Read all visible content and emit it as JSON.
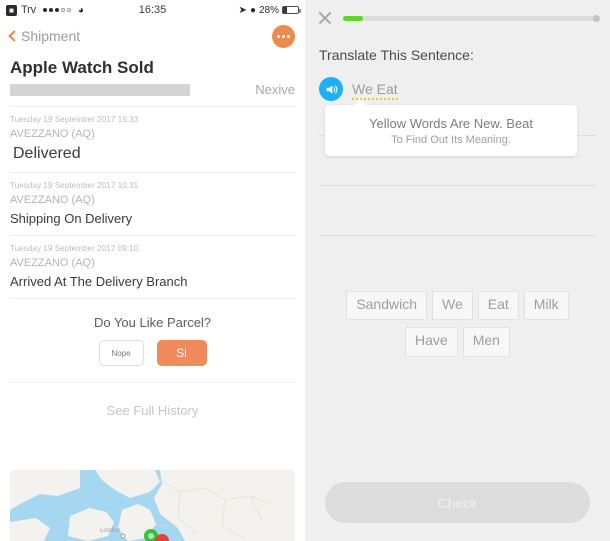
{
  "status_bar": {
    "carrier_icon": "carrier-badge-icon",
    "carrier": "Trv",
    "signal_dots": [
      true,
      true,
      true,
      false,
      false
    ],
    "wifi_icon": "wifi-icon",
    "time": "16:35",
    "location_icon": "location-arrow-icon",
    "alarm_icon": "alarm-icon",
    "battery_percent": "28%",
    "battery_icon": "battery-icon"
  },
  "left_panel": {
    "nav": {
      "back_icon": "chevron-left-icon",
      "back_label": "Shipment",
      "more_button_icon": "ellipsis-icon"
    },
    "shipment": {
      "title": "Apple Watch Sold",
      "code_placeholder_bar": "redacted-tracking-code",
      "carrier_name": "Nexive"
    },
    "events": [
      {
        "timestamp": "Tuesday 19 September 2017 15:33",
        "location": "AVEZZANO (AQ)",
        "status": "Delivered",
        "emphasis": true
      },
      {
        "timestamp": "Tuesday 19 September 2017 10:31",
        "location": "AVEZZANO (AQ)",
        "status": "Shipping On Delivery",
        "emphasis": false
      },
      {
        "timestamp": "Tuesday 19 September 2017 09:10",
        "location": "AVEZZANO (AQ)",
        "status": "Arrived At The Delivery Branch",
        "emphasis": false
      }
    ],
    "feedback": {
      "question": "Do You Like Parcel?",
      "no_label": "Nope",
      "yes_label": "Si"
    },
    "history_link": "See Full History",
    "map": {
      "label_london": "London",
      "marker_green": "map-marker-green",
      "marker_red": "map-marker-red"
    }
  },
  "right_panel": {
    "close_icon": "close-icon",
    "progress": {
      "value_percent": 8,
      "fill_color": "#5fd52a",
      "track_color": "#dcdcdc"
    },
    "prompt": "Translate This Sentence:",
    "speaker_icon": "speaker-icon",
    "sentence": "We Eat",
    "tooltip": {
      "line1": "Yellow Words Are New. Beat",
      "line2": "To Find Out Its Meaning."
    },
    "answer_line_count": 3,
    "word_bank_rows": [
      [
        "Sandwich",
        "We",
        "Eat",
        "Milk"
      ],
      [
        "Have",
        "Men"
      ]
    ],
    "check_label": "Check"
  }
}
